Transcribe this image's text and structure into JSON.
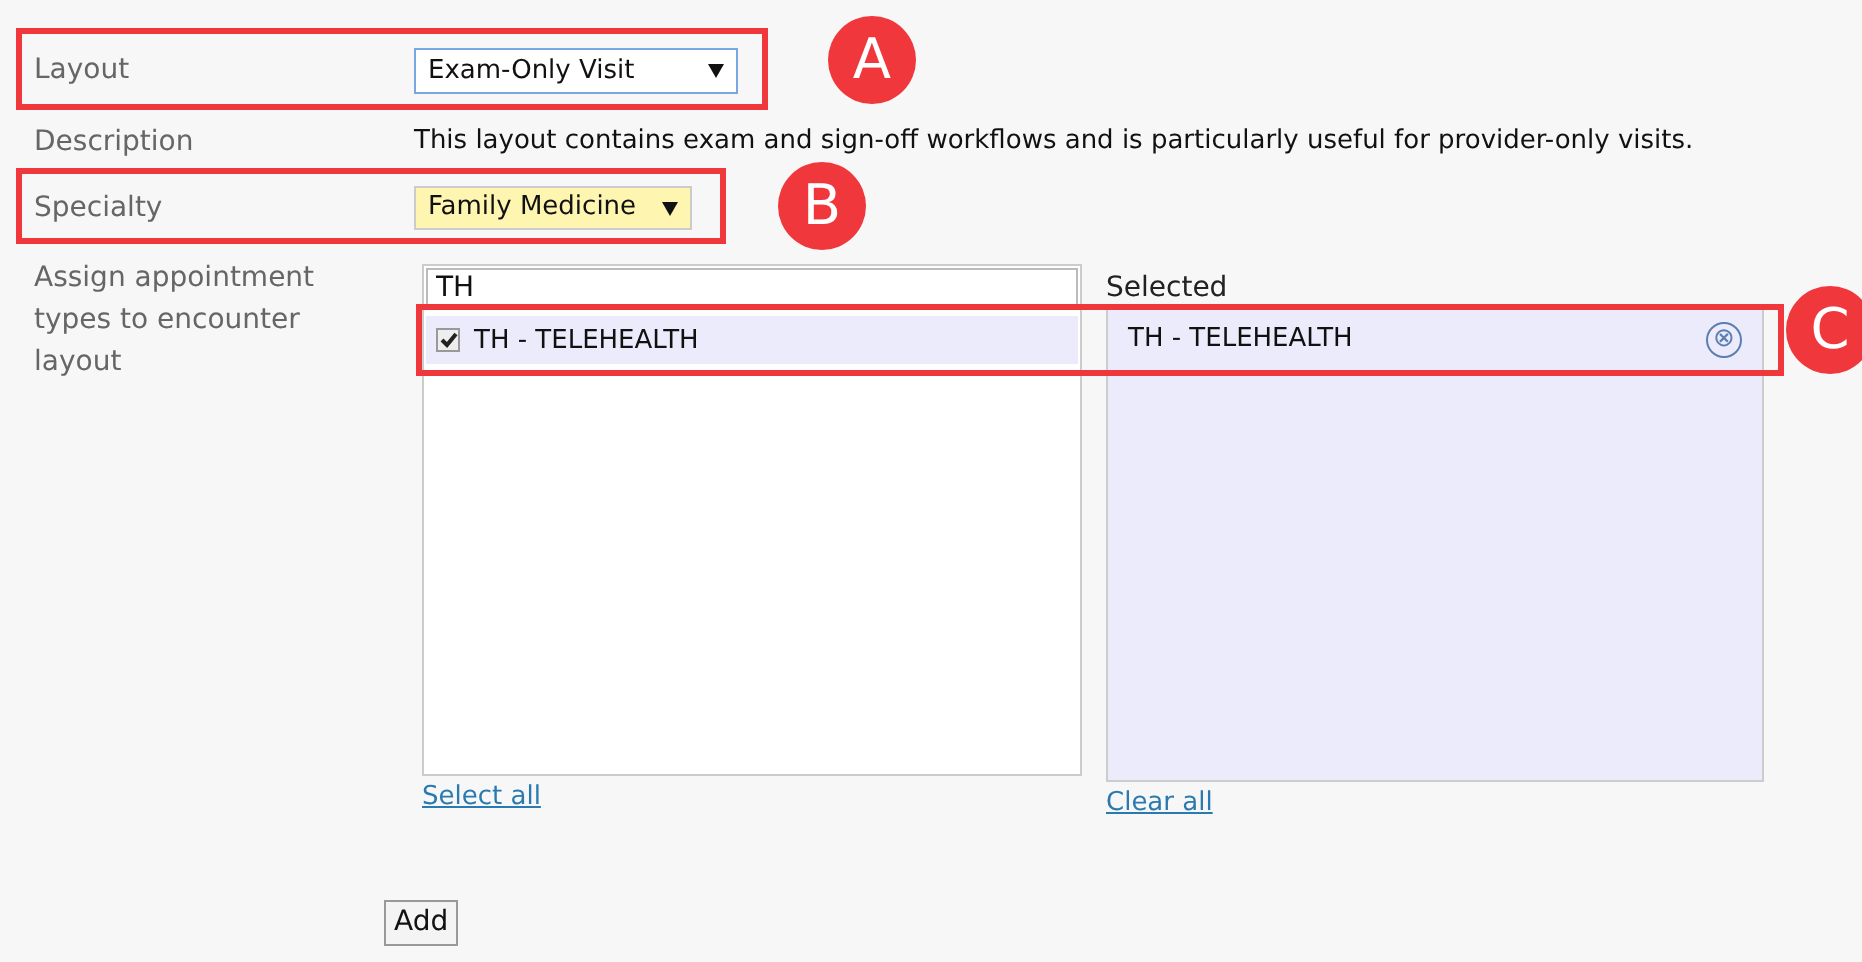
{
  "fields": [
    {
      "label": "Layout",
      "kind": "select",
      "value": "Exam-Only Visit",
      "highlighted": false
    },
    {
      "label": "Description",
      "kind": "text",
      "value": "This layout contains exam and sign-off workflows and is particularly useful for provider-only visits."
    },
    {
      "label": "Specialty",
      "kind": "select",
      "value": "Family Medicine",
      "highlighted": true
    }
  ],
  "assign": {
    "label": "Assign appointment types to encounter layout",
    "search": {
      "value": "TH"
    },
    "options": [
      {
        "label": "TH - TELEHEALTH",
        "checked": true
      }
    ],
    "select_all": "Select all",
    "selected_heading": "Selected",
    "selected": [
      {
        "label": "TH - TELEHEALTH",
        "remove": "⊗"
      }
    ],
    "clear_all": "Clear all"
  },
  "add_button": "Add",
  "callouts": [
    {
      "letter": "A"
    },
    {
      "letter": "B"
    },
    {
      "letter": "C"
    }
  ]
}
